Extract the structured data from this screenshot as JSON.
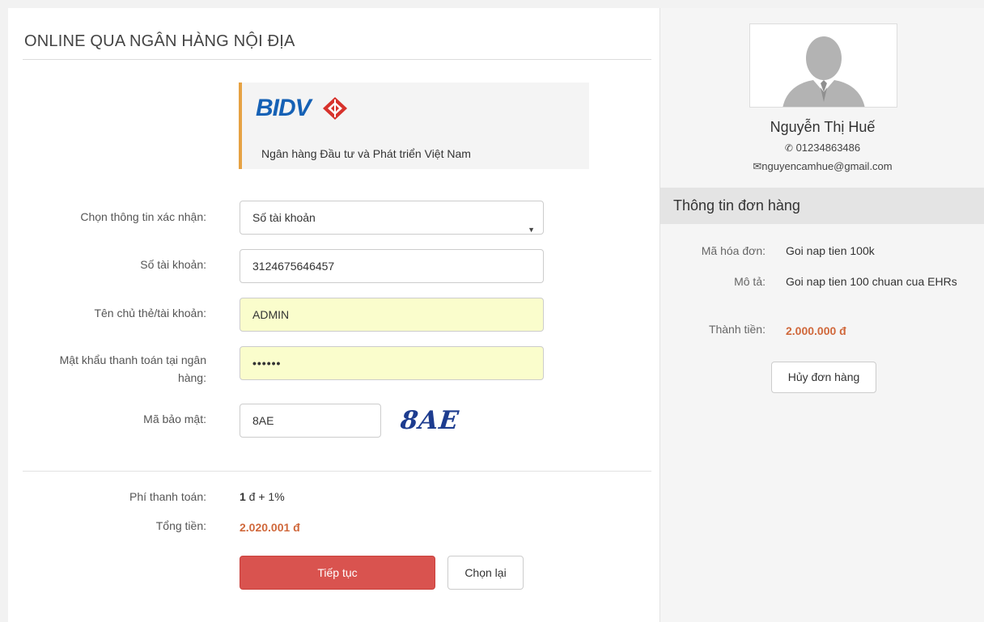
{
  "payment": {
    "title": "ONLINE QUA NGÂN HÀNG NỘI ĐỊA",
    "bank": {
      "logo_text": "BIDV",
      "name": "Ngân hàng Đầu tư và Phát triển Việt Nam",
      "accent_color": "#e6a243",
      "logo_color": "#1561b5"
    },
    "form": {
      "verify_label": "Chọn thông tin xác nhận:",
      "verify_value": "Số tài khoản",
      "account_label": "Số tài khoản:",
      "account_value": "3124675646457",
      "holder_label": "Tên chủ thẻ/tài khoản:",
      "holder_value": "ADMIN",
      "password_label_line1": "Mật khẩu thanh toán tại ngân",
      "password_label_line2": "hàng:",
      "password_value": "••••••",
      "security_label": "Mã bảo mật:",
      "security_value": "8AE",
      "captcha_text": "8AE"
    },
    "fee_label": "Phí thanh toán:",
    "fee_bold": "1",
    "fee_rest": " đ + 1%",
    "total_label": "Tổng tiền:",
    "total_value": "2.020.001 đ",
    "continue_button": "Tiếp tục",
    "reset_button": "Chọn lại",
    "primary_color": "#d9534f"
  },
  "customer": {
    "name": "Nguyễn Thị Huế",
    "phone": "01234863486",
    "email": "nguyencamhue@gmail.com",
    "avatar_icon": "user-silhouette-icon"
  },
  "order": {
    "header": "Thông tin đơn hàng",
    "invoice_label": "Mã hóa đơn:",
    "invoice_value": "Goi nap tien 100k",
    "desc_label": "Mô tả:",
    "desc_value": "Goi nap tien 100 chuan cua EHRs",
    "amount_label": "Thành tiền:",
    "amount_value": "2.000.000 đ",
    "cancel_button": "Hủy đơn hàng",
    "amount_color": "#d0683b"
  }
}
